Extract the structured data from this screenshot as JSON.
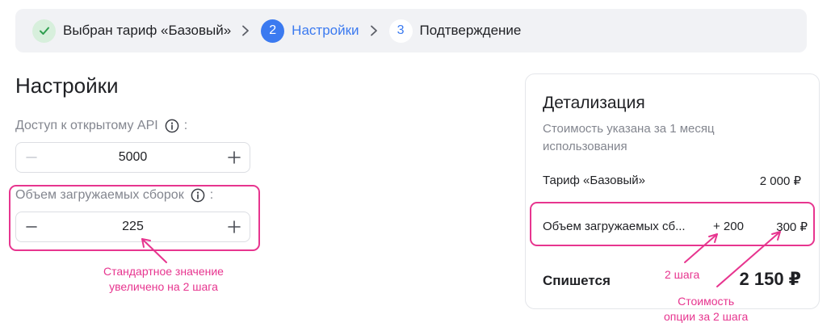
{
  "stepper": {
    "steps": [
      {
        "marker": "✓",
        "label": "Выбран тариф «Базовый»",
        "state": "done"
      },
      {
        "marker": "2",
        "label": "Настройки",
        "state": "active"
      },
      {
        "marker": "3",
        "label": "Подтверждение",
        "state": "todo"
      }
    ]
  },
  "settings": {
    "title": "Настройки",
    "api_access": {
      "label": "Доступ к открытому API",
      "colon": ":",
      "value": "5000",
      "minus": "−",
      "plus": "+"
    },
    "builds": {
      "label": "Объем загружаемых сборок",
      "colon": ":",
      "value": "225",
      "minus": "−",
      "plus": "+"
    }
  },
  "details": {
    "title": "Детализация",
    "subtitle": "Стоимость указана за 1 месяц использования",
    "tariff": {
      "label": "Тариф «Базовый»",
      "value": "2 000 ₽"
    },
    "builds": {
      "label": "Объем загружаемых сб...",
      "delta": "+ 200",
      "value": "300 ₽"
    },
    "total": {
      "label": "Спишется",
      "value": "2 150 ₽"
    }
  },
  "annotations": {
    "left": "Стандартное значение\nувеличено на 2 шага",
    "steps": "2 шага",
    "cost": "Стоимость\nопции за 2 шага"
  },
  "colors": {
    "accent": "#3b7af0",
    "annotation": "#e7358f",
    "success": "#2e9e4f"
  }
}
